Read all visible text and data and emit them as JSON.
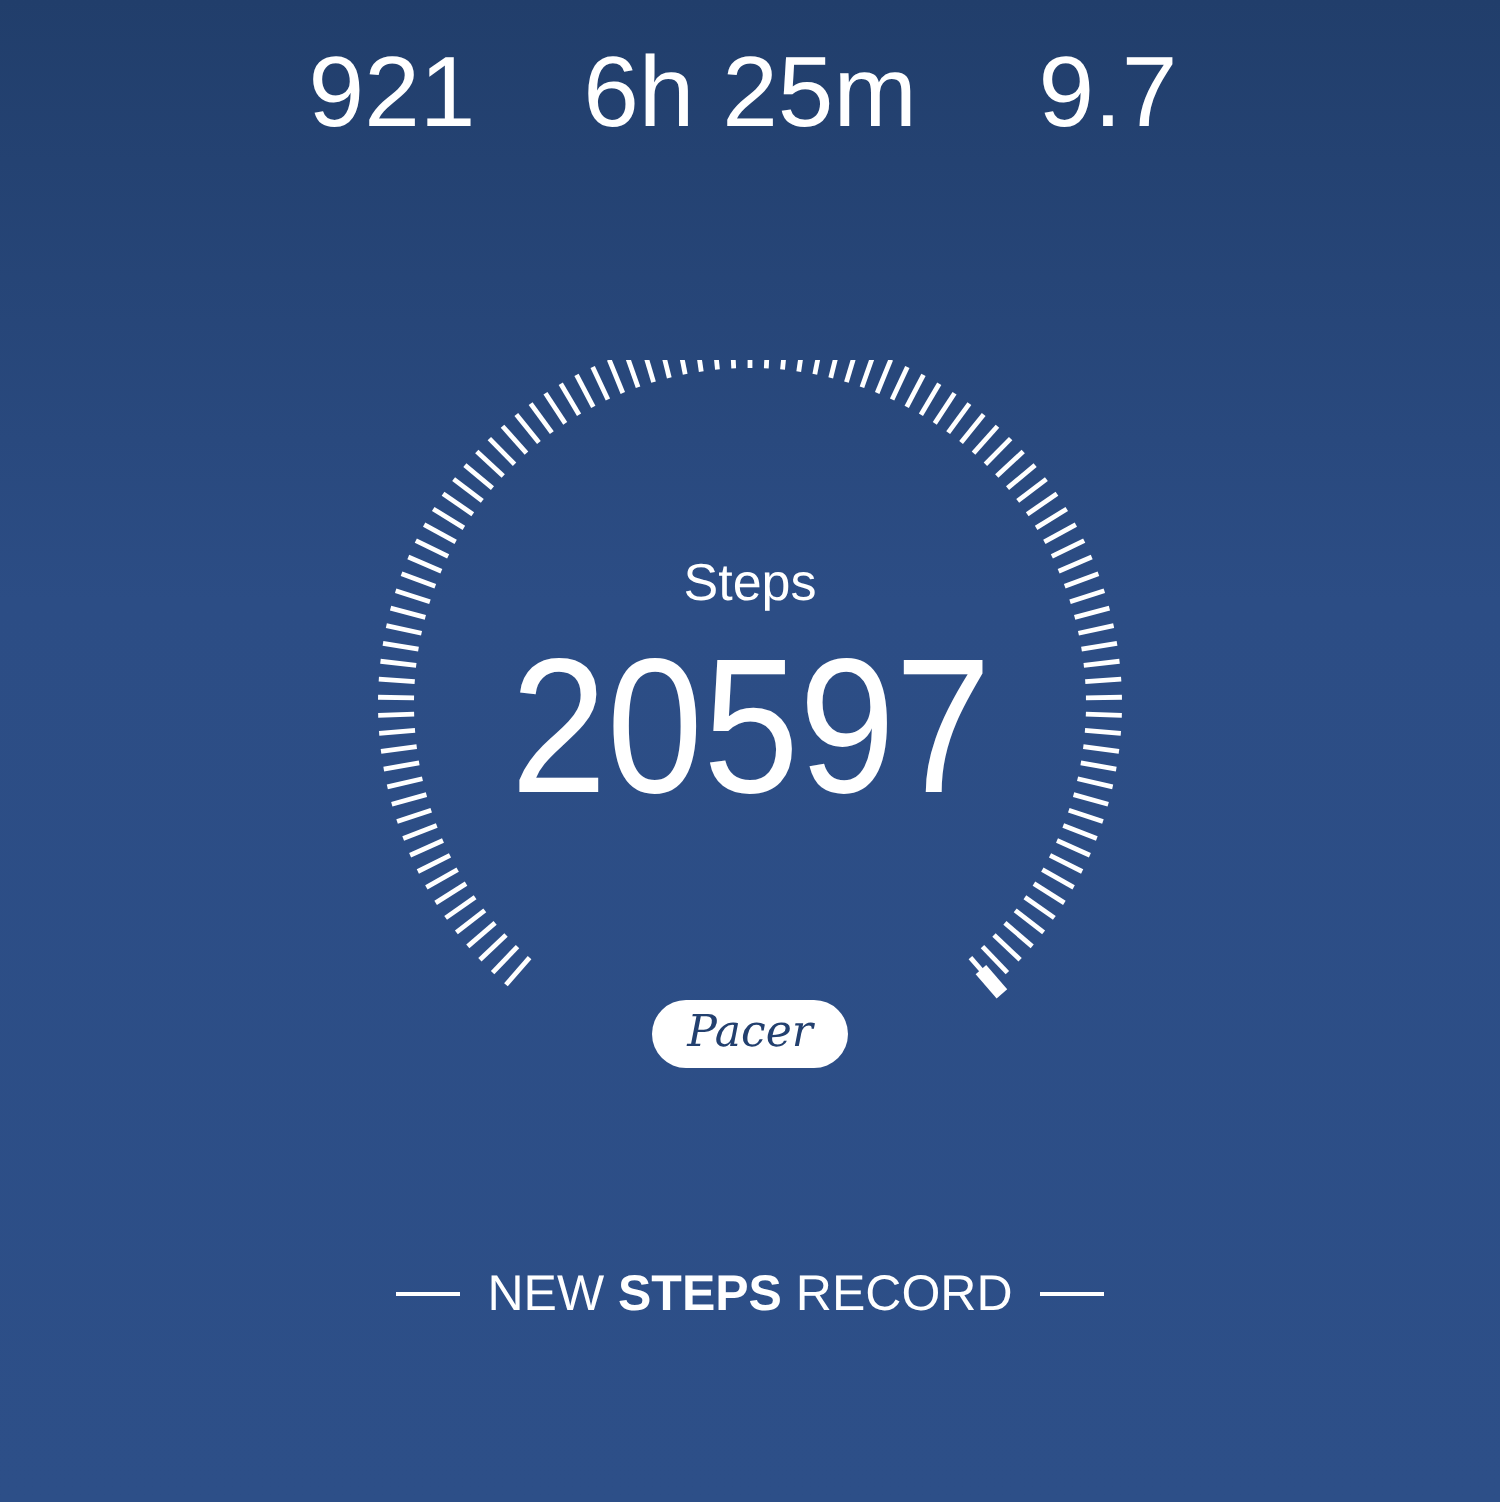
{
  "stats": [
    {
      "value": "921"
    },
    {
      "value": "6h 25m"
    },
    {
      "value": "9.7"
    }
  ],
  "gauge": {
    "label": "Steps",
    "value": "20597"
  },
  "badge": "Pacer",
  "banner": "NEW **STEPS** RECORD"
}
